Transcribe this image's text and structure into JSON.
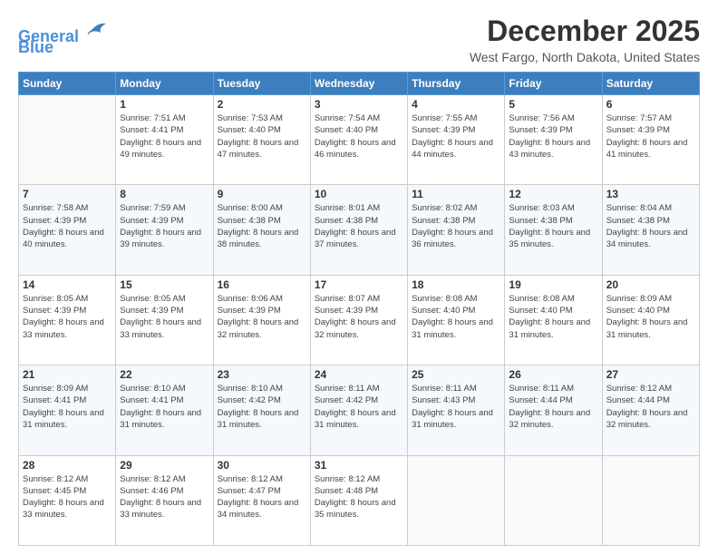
{
  "logo": {
    "line1": "General",
    "line2": "Blue"
  },
  "title": "December 2025",
  "location": "West Fargo, North Dakota, United States",
  "days_of_week": [
    "Sunday",
    "Monday",
    "Tuesday",
    "Wednesday",
    "Thursday",
    "Friday",
    "Saturday"
  ],
  "weeks": [
    [
      {
        "day": "",
        "sunrise": "",
        "sunset": "",
        "daylight": ""
      },
      {
        "day": "1",
        "sunrise": "Sunrise: 7:51 AM",
        "sunset": "Sunset: 4:41 PM",
        "daylight": "Daylight: 8 hours and 49 minutes."
      },
      {
        "day": "2",
        "sunrise": "Sunrise: 7:53 AM",
        "sunset": "Sunset: 4:40 PM",
        "daylight": "Daylight: 8 hours and 47 minutes."
      },
      {
        "day": "3",
        "sunrise": "Sunrise: 7:54 AM",
        "sunset": "Sunset: 4:40 PM",
        "daylight": "Daylight: 8 hours and 46 minutes."
      },
      {
        "day": "4",
        "sunrise": "Sunrise: 7:55 AM",
        "sunset": "Sunset: 4:39 PM",
        "daylight": "Daylight: 8 hours and 44 minutes."
      },
      {
        "day": "5",
        "sunrise": "Sunrise: 7:56 AM",
        "sunset": "Sunset: 4:39 PM",
        "daylight": "Daylight: 8 hours and 43 minutes."
      },
      {
        "day": "6",
        "sunrise": "Sunrise: 7:57 AM",
        "sunset": "Sunset: 4:39 PM",
        "daylight": "Daylight: 8 hours and 41 minutes."
      }
    ],
    [
      {
        "day": "7",
        "sunrise": "Sunrise: 7:58 AM",
        "sunset": "Sunset: 4:39 PM",
        "daylight": "Daylight: 8 hours and 40 minutes."
      },
      {
        "day": "8",
        "sunrise": "Sunrise: 7:59 AM",
        "sunset": "Sunset: 4:39 PM",
        "daylight": "Daylight: 8 hours and 39 minutes."
      },
      {
        "day": "9",
        "sunrise": "Sunrise: 8:00 AM",
        "sunset": "Sunset: 4:38 PM",
        "daylight": "Daylight: 8 hours and 38 minutes."
      },
      {
        "day": "10",
        "sunrise": "Sunrise: 8:01 AM",
        "sunset": "Sunset: 4:38 PM",
        "daylight": "Daylight: 8 hours and 37 minutes."
      },
      {
        "day": "11",
        "sunrise": "Sunrise: 8:02 AM",
        "sunset": "Sunset: 4:38 PM",
        "daylight": "Daylight: 8 hours and 36 minutes."
      },
      {
        "day": "12",
        "sunrise": "Sunrise: 8:03 AM",
        "sunset": "Sunset: 4:38 PM",
        "daylight": "Daylight: 8 hours and 35 minutes."
      },
      {
        "day": "13",
        "sunrise": "Sunrise: 8:04 AM",
        "sunset": "Sunset: 4:38 PM",
        "daylight": "Daylight: 8 hours and 34 minutes."
      }
    ],
    [
      {
        "day": "14",
        "sunrise": "Sunrise: 8:05 AM",
        "sunset": "Sunset: 4:39 PM",
        "daylight": "Daylight: 8 hours and 33 minutes."
      },
      {
        "day": "15",
        "sunrise": "Sunrise: 8:05 AM",
        "sunset": "Sunset: 4:39 PM",
        "daylight": "Daylight: 8 hours and 33 minutes."
      },
      {
        "day": "16",
        "sunrise": "Sunrise: 8:06 AM",
        "sunset": "Sunset: 4:39 PM",
        "daylight": "Daylight: 8 hours and 32 minutes."
      },
      {
        "day": "17",
        "sunrise": "Sunrise: 8:07 AM",
        "sunset": "Sunset: 4:39 PM",
        "daylight": "Daylight: 8 hours and 32 minutes."
      },
      {
        "day": "18",
        "sunrise": "Sunrise: 8:08 AM",
        "sunset": "Sunset: 4:40 PM",
        "daylight": "Daylight: 8 hours and 31 minutes."
      },
      {
        "day": "19",
        "sunrise": "Sunrise: 8:08 AM",
        "sunset": "Sunset: 4:40 PM",
        "daylight": "Daylight: 8 hours and 31 minutes."
      },
      {
        "day": "20",
        "sunrise": "Sunrise: 8:09 AM",
        "sunset": "Sunset: 4:40 PM",
        "daylight": "Daylight: 8 hours and 31 minutes."
      }
    ],
    [
      {
        "day": "21",
        "sunrise": "Sunrise: 8:09 AM",
        "sunset": "Sunset: 4:41 PM",
        "daylight": "Daylight: 8 hours and 31 minutes."
      },
      {
        "day": "22",
        "sunrise": "Sunrise: 8:10 AM",
        "sunset": "Sunset: 4:41 PM",
        "daylight": "Daylight: 8 hours and 31 minutes."
      },
      {
        "day": "23",
        "sunrise": "Sunrise: 8:10 AM",
        "sunset": "Sunset: 4:42 PM",
        "daylight": "Daylight: 8 hours and 31 minutes."
      },
      {
        "day": "24",
        "sunrise": "Sunrise: 8:11 AM",
        "sunset": "Sunset: 4:42 PM",
        "daylight": "Daylight: 8 hours and 31 minutes."
      },
      {
        "day": "25",
        "sunrise": "Sunrise: 8:11 AM",
        "sunset": "Sunset: 4:43 PM",
        "daylight": "Daylight: 8 hours and 31 minutes."
      },
      {
        "day": "26",
        "sunrise": "Sunrise: 8:11 AM",
        "sunset": "Sunset: 4:44 PM",
        "daylight": "Daylight: 8 hours and 32 minutes."
      },
      {
        "day": "27",
        "sunrise": "Sunrise: 8:12 AM",
        "sunset": "Sunset: 4:44 PM",
        "daylight": "Daylight: 8 hours and 32 minutes."
      }
    ],
    [
      {
        "day": "28",
        "sunrise": "Sunrise: 8:12 AM",
        "sunset": "Sunset: 4:45 PM",
        "daylight": "Daylight: 8 hours and 33 minutes."
      },
      {
        "day": "29",
        "sunrise": "Sunrise: 8:12 AM",
        "sunset": "Sunset: 4:46 PM",
        "daylight": "Daylight: 8 hours and 33 minutes."
      },
      {
        "day": "30",
        "sunrise": "Sunrise: 8:12 AM",
        "sunset": "Sunset: 4:47 PM",
        "daylight": "Daylight: 8 hours and 34 minutes."
      },
      {
        "day": "31",
        "sunrise": "Sunrise: 8:12 AM",
        "sunset": "Sunset: 4:48 PM",
        "daylight": "Daylight: 8 hours and 35 minutes."
      },
      {
        "day": "",
        "sunrise": "",
        "sunset": "",
        "daylight": ""
      },
      {
        "day": "",
        "sunrise": "",
        "sunset": "",
        "daylight": ""
      },
      {
        "day": "",
        "sunrise": "",
        "sunset": "",
        "daylight": ""
      }
    ]
  ]
}
